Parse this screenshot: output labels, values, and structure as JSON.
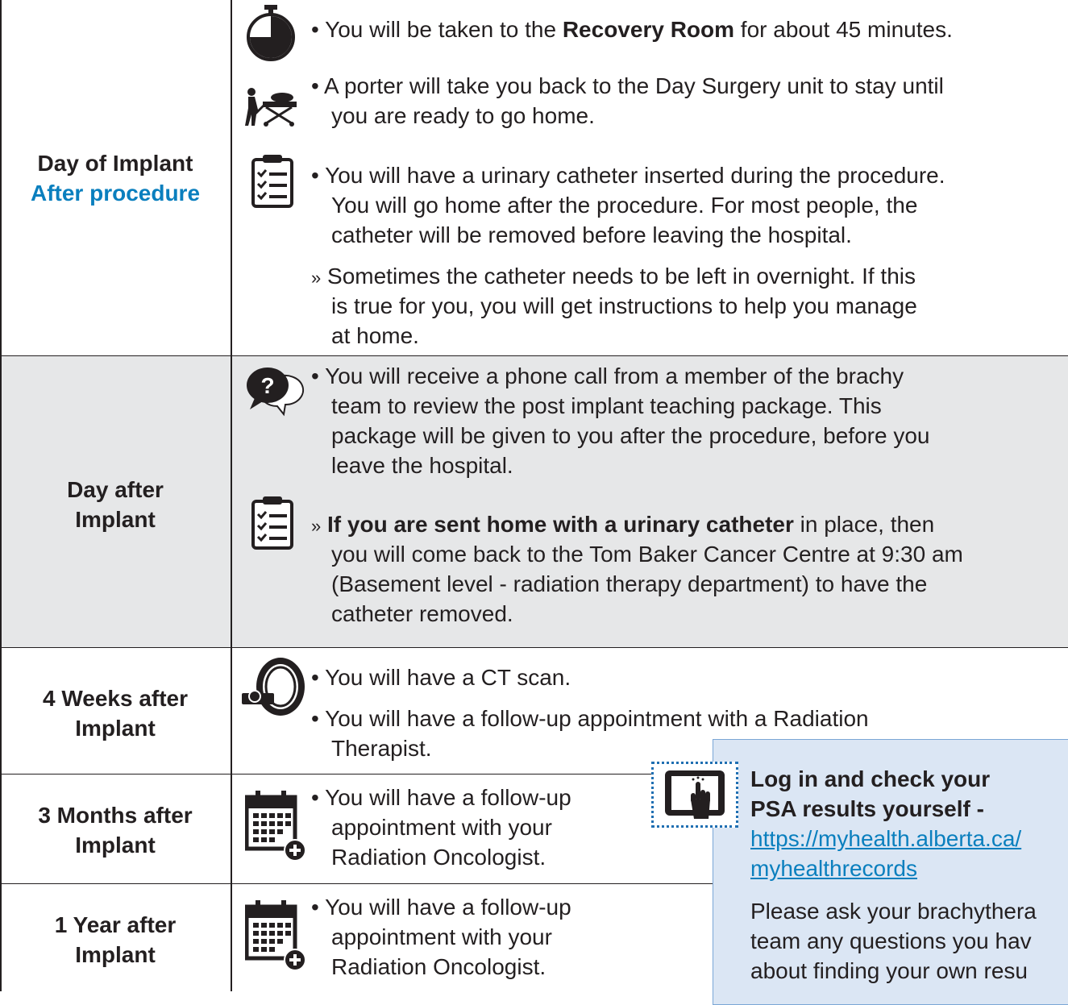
{
  "rows": [
    {
      "label_lines": [
        "Day of Implant"
      ],
      "accent_line": "After procedure",
      "items": [
        {
          "icon": "stopwatch-icon",
          "bullet": "•",
          "pre": "You will be taken to the ",
          "bold": "Recovery Room",
          "post": " for about 45 minutes."
        },
        {
          "icon": "stretcher-porter-icon",
          "bullet": "•",
          "lines": [
            "A porter will take you back to the Day Surgery unit to stay until",
            "you are ready to go home."
          ]
        },
        {
          "icon": "clipboard-checklist-icon",
          "bullet": "•",
          "lines": [
            "You will have a urinary catheter inserted during the procedure.",
            "You will go home after the procedure. For most people, the",
            "catheter will be removed before leaving the hospital."
          ]
        },
        {
          "bullet": "»",
          "lines": [
            "Sometimes the catheter needs to be left in overnight. If this",
            "is true for you, you will get instructions to help you manage",
            "at home."
          ]
        }
      ]
    },
    {
      "label_lines": [
        "Day after",
        "Implant"
      ],
      "items": [
        {
          "icon": "question-speech-bubbles-icon",
          "bullet": "•",
          "lines": [
            "You will receive a phone call from a member of the brachy",
            "team to review the post implant teaching package. This",
            "package will be given to you after the procedure, before you",
            "leave the hospital."
          ]
        },
        {
          "icon": "clipboard-checklist-icon",
          "bullet": "»",
          "bold": "If you are sent home with a urinary catheter",
          "post": " in place, then",
          "lines": [
            "you will come back to the Tom Baker Cancer Centre at 9:30 am",
            "(Basement level - radiation therapy department) to have the",
            "catheter removed."
          ]
        }
      ]
    },
    {
      "label_lines": [
        "4 Weeks after",
        "Implant"
      ],
      "items": [
        {
          "icon": "ct-scanner-icon",
          "bullet": "•",
          "lines": [
            "You will have a CT scan."
          ]
        },
        {
          "bullet": "•",
          "lines": [
            "You will have a follow-up appointment with a Radiation",
            "Therapist."
          ]
        }
      ]
    },
    {
      "label_lines": [
        "3 Months after",
        "Implant"
      ],
      "items": [
        {
          "icon": "calendar-add-icon",
          "bullet": "•",
          "lines": [
            "You will have a follow-up",
            "appointment with your",
            "Radiation Oncologist."
          ]
        }
      ]
    },
    {
      "label_lines": [
        "1 Year after",
        "Implant"
      ],
      "items": [
        {
          "icon": "calendar-add-icon",
          "bullet": "•",
          "lines": [
            "You will have a follow-up",
            "appointment with your",
            "Radiation Oncologist."
          ]
        }
      ]
    }
  ],
  "callout": {
    "icon": "tablet-touch-icon",
    "heading": [
      "Log in and check your",
      "PSA results yourself -"
    ],
    "link": [
      "https://myhealth.alberta.ca/",
      "myhealthrecords"
    ],
    "body": [
      "Please ask your brachythera",
      "team any questions you hav",
      "about finding your own resu"
    ]
  },
  "colors": {
    "accent": "#0a7fbe",
    "row_shade": "#e6e7e8",
    "callout_bg": "#dbe6f4",
    "text": "#231f20"
  }
}
